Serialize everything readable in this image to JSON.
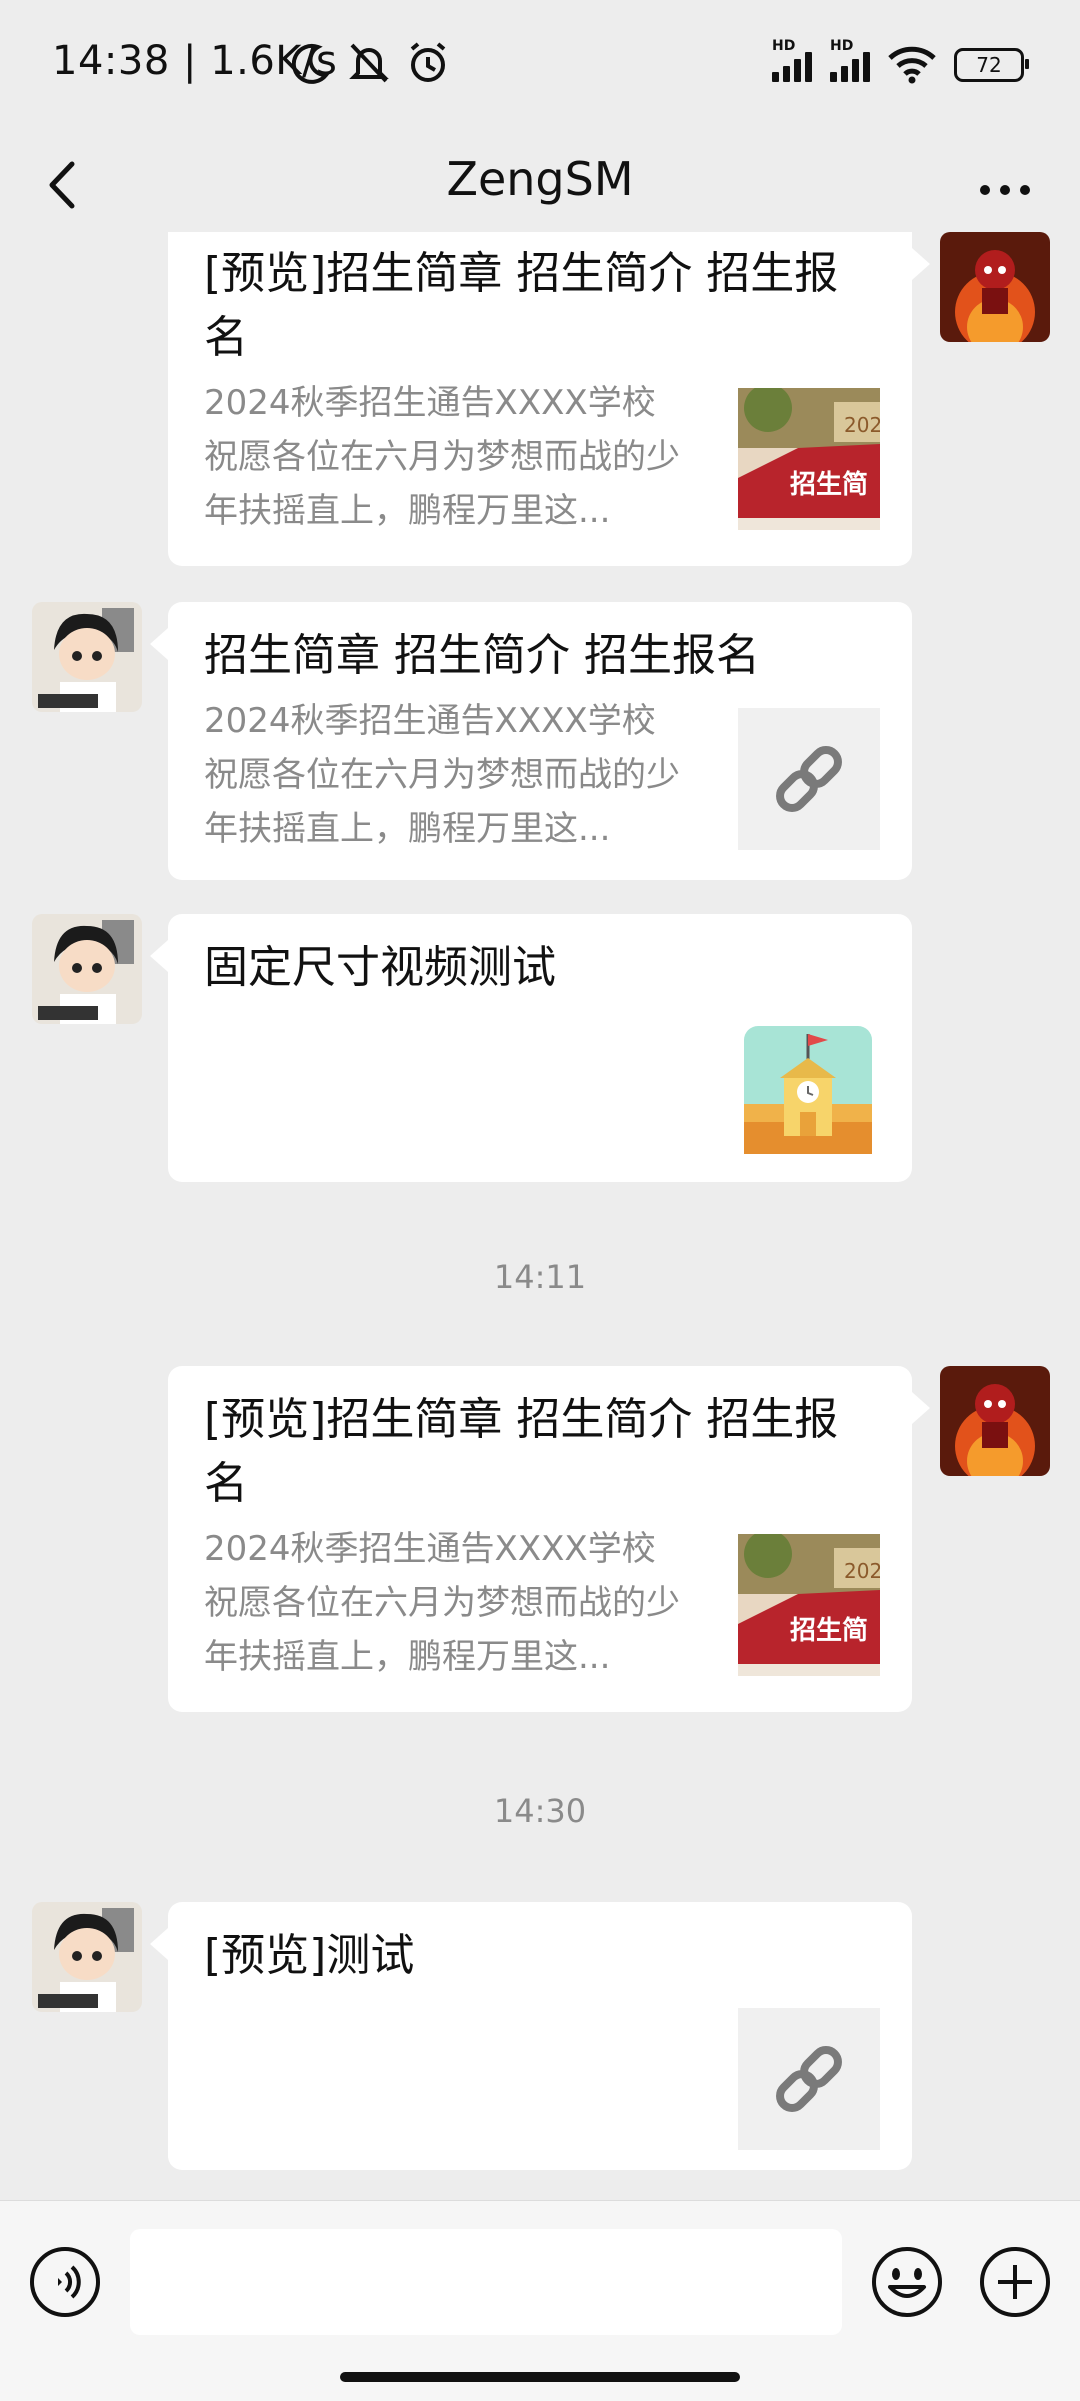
{
  "status": {
    "time": "14:38",
    "speed": "| 1.6K/s",
    "hd1": "HD",
    "hd2": "HD",
    "battery": "72"
  },
  "header": {
    "title": "ZengSM"
  },
  "messages": [
    {
      "side": "right",
      "title": "[预览]招生简章 招生简介 招生报名",
      "desc": "2024秋季招生通告XXXX学校祝愿各位在六月为梦想而战的少年扶摇直上，鹏程万里这...",
      "thumb": "poster",
      "thumb_text": "招生简",
      "thumb_year": "202"
    },
    {
      "side": "left",
      "title": "招生简章 招生简介 招生报名",
      "desc": "2024秋季招生通告XXXX学校祝愿各位在六月为梦想而战的少年扶摇直上，鹏程万里这...",
      "thumb": "link-icon"
    },
    {
      "side": "left",
      "title": "固定尺寸视频测试",
      "desc": "",
      "thumb": "school-icon"
    },
    {
      "side": "right",
      "title": "[预览]招生简章 招生简介 招生报名",
      "desc": "2024秋季招生通告XXXX学校祝愿各位在六月为梦想而战的少年扶摇直上，鹏程万里这...",
      "thumb": "poster",
      "thumb_text": "招生简",
      "thumb_year": "202"
    },
    {
      "side": "left",
      "title": "[预览]测试",
      "desc": "",
      "thumb": "link-icon"
    }
  ],
  "timestamps": [
    "14:11",
    "14:30"
  ],
  "colors": {
    "background": "#ededed",
    "bubble": "#ffffff",
    "secondary_text": "#8a8a8a"
  }
}
